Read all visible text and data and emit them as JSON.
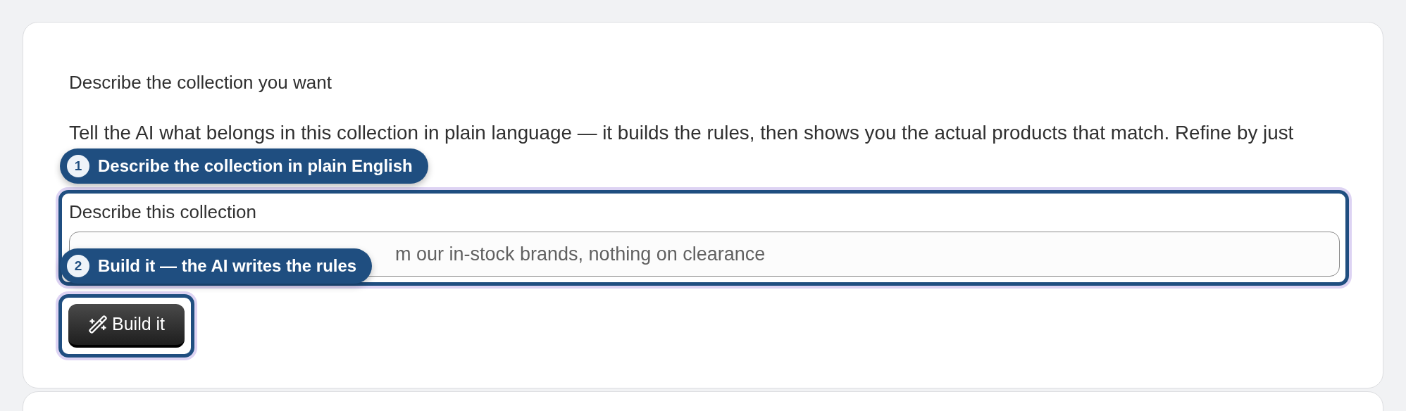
{
  "heading": "Describe the collection you want",
  "description": "Tell the AI what belongs in this collection in plain language — it builds the rules, then shows you the actual products that match. Refine by just",
  "field": {
    "label": "Describe this collection",
    "placeholder": "m our in-stock brands, nothing on clearance"
  },
  "button": {
    "label": "Build it"
  },
  "callouts": [
    {
      "number": "1",
      "text": "Describe the collection in plain English"
    },
    {
      "number": "2",
      "text": "Build it — the AI writes the rules"
    }
  ]
}
